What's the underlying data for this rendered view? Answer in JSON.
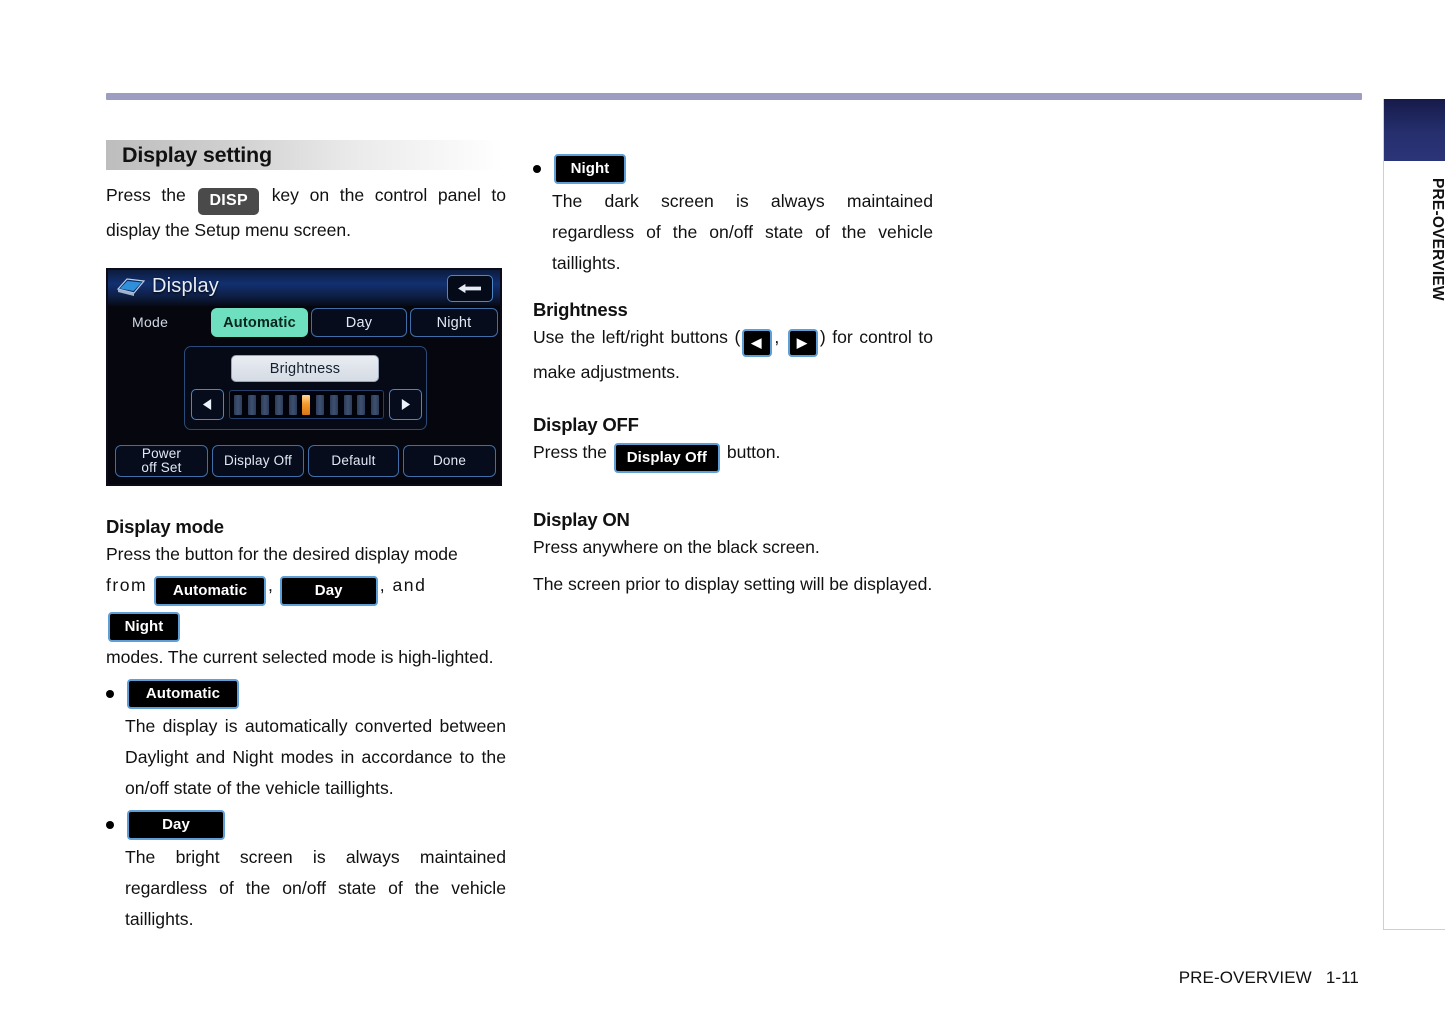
{
  "page": {
    "footer_section": "PRE-OVERVIEW",
    "footer_page": "1-11",
    "side_tab_label": "PRE-OVERVIEW",
    "rule_color": "#9d9dc2"
  },
  "left_column": {
    "section_title": "Display setting",
    "intro_before": "Press the",
    "intro_key": "DISP",
    "intro_after": "key on the control panel to display the Setup menu screen.",
    "display_mode": {
      "heading": "Display mode",
      "para_1": "Press the button for the desired display mode",
      "para_from": "from",
      "chip_automatic": "Automatic",
      "comma_1": ",",
      "chip_day": "Day",
      "and_text": ", and",
      "chip_night": "Night",
      "para_2": "modes. The current selected mode is high-lighted."
    },
    "bullets": [
      {
        "chip": "Automatic",
        "text": "The display is automatically converted between Daylight and Night modes in accordance to the on/off state of the vehicle taillights."
      },
      {
        "chip": "Day",
        "text": "The bright screen is always maintained regardless of the on/off state of the vehicle taillights."
      }
    ]
  },
  "right_column": {
    "bullets": [
      {
        "chip": "Night",
        "text": "The dark screen is always maintained regardless of the on/off state of the vehicle taillights."
      }
    ],
    "brightness": {
      "heading": "Brightness",
      "text_before": "Use the left/right buttons (",
      "chip_left": "◀",
      "sep": ",",
      "chip_right": "▶",
      "text_after": ") for control to make adjustments."
    },
    "display_off": {
      "heading": "Display OFF",
      "text_before": "Press the",
      "chip": "Display Off",
      "text_after": "button."
    },
    "display_on": {
      "heading": "Display ON",
      "line_1": "Press anywhere on the black screen.",
      "line_2": "The screen prior to display setting will be displayed."
    }
  },
  "nav_screen": {
    "title": "Display",
    "back_glyph": "←",
    "mode_label": "Mode",
    "modes": [
      {
        "label": "Automatic",
        "selected": true
      },
      {
        "label": "Day",
        "selected": false
      },
      {
        "label": "Night",
        "selected": false
      }
    ],
    "brightness_label": "Brightness",
    "arrow_left": "◀",
    "arrow_right": "▶",
    "brightness_bars_total": 11,
    "brightness_active_index": 6,
    "bottom_buttons": [
      "Power\noff Set",
      "Display Off",
      "Default",
      "Done"
    ],
    "colors": {
      "selected_mode": "#6fe0bf",
      "active_bar": "#f59a2a",
      "titlebar": "#123070",
      "button_border": "#3f6ea8"
    }
  }
}
